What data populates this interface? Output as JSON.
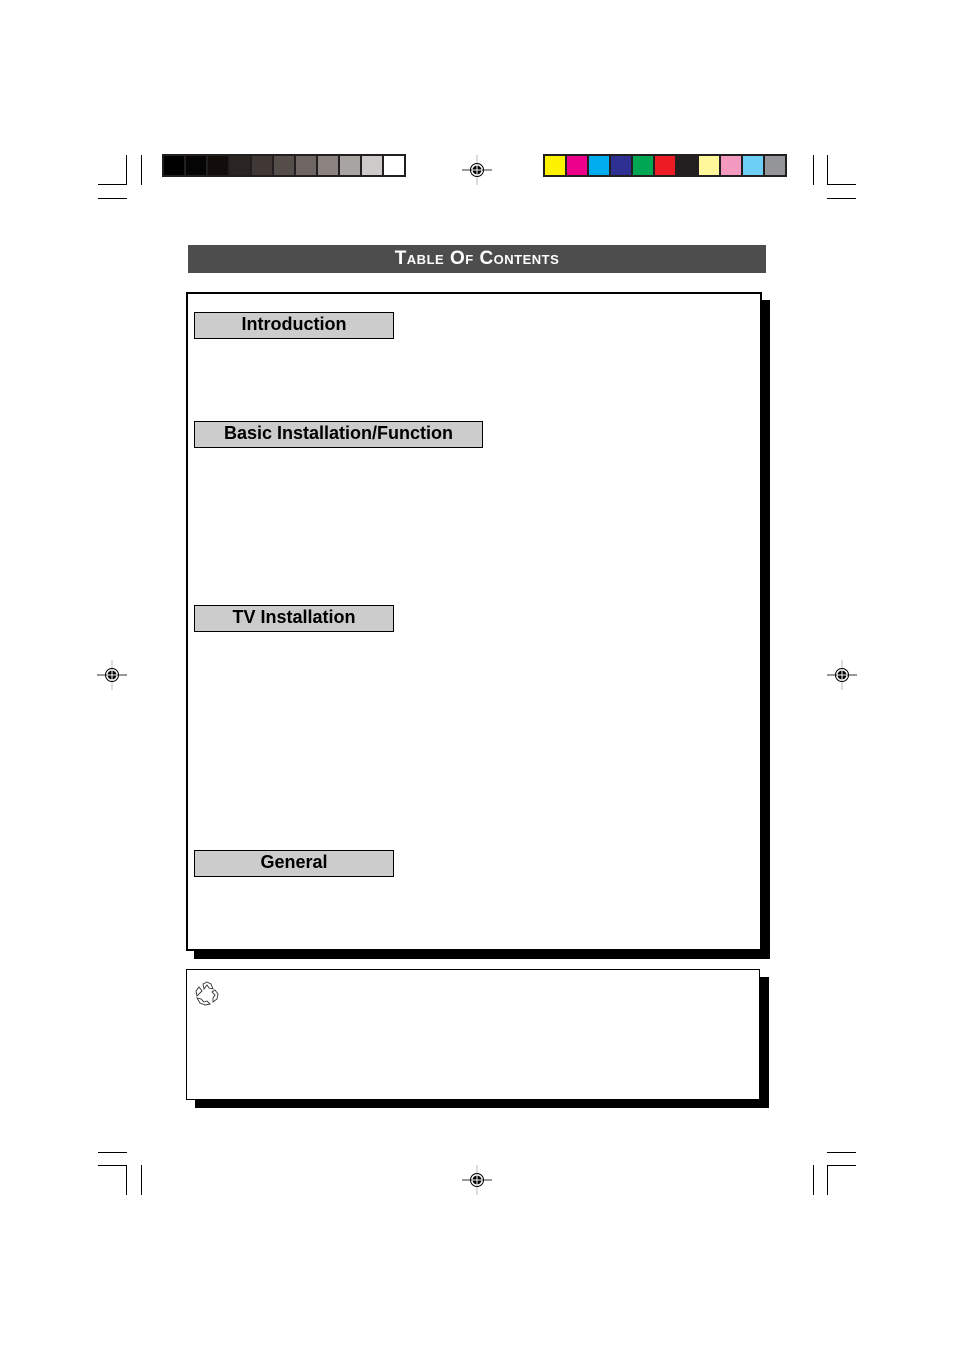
{
  "page": {
    "title": "Table Of Contents",
    "sections": [
      {
        "label": "Introduction"
      },
      {
        "label": "Basic Installation/Function"
      },
      {
        "label": "TV Installation"
      },
      {
        "label": "General"
      }
    ],
    "note_box": {
      "icon": "recycle-icon"
    }
  },
  "print_marks": {
    "grayscale_swatches": [
      "#000000",
      "#050505",
      "#120d0a",
      "#2a2523",
      "#3f3835",
      "#554d4a",
      "#6e6662",
      "#8a8380",
      "#a8a4a2",
      "#cdcaca",
      "#ffffff"
    ],
    "color_swatches": [
      "#fff200",
      "#ec008c",
      "#00aeef",
      "#2e3192",
      "#00a651",
      "#ed1c24",
      "#231f20",
      "#fff799",
      "#f49ac1",
      "#6dcff6",
      "#939598"
    ],
    "registration_marks": [
      "top-center",
      "left-middle",
      "right-middle",
      "bottom-center"
    ]
  }
}
